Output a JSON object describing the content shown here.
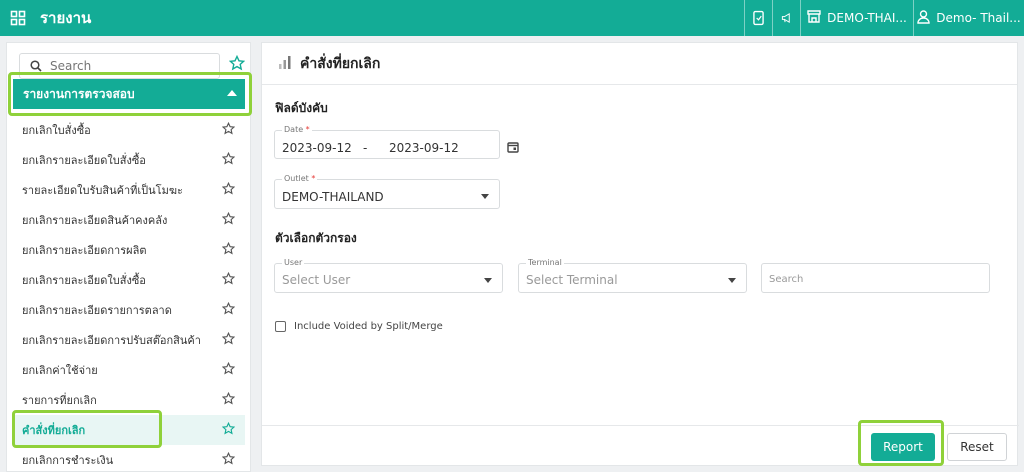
{
  "topbar": {
    "title": "รายงาน",
    "outlet": "DEMO-THAI...",
    "user": "Demo- Thail...",
    "icons": [
      "grid-icon",
      "device-icon",
      "megaphone-icon",
      "store-icon",
      "user-icon"
    ],
    "bg_color": "#13ac96"
  },
  "sidebar": {
    "search_placeholder": "Search",
    "group_label": "รายงานการตรวจสอบ",
    "items": [
      {
        "label": "ยกเลิกใบสั่งซื้อ"
      },
      {
        "label": "ยกเลิกรายละเอียดใบสั่งซื้อ"
      },
      {
        "label": "รายละเอียดใบรับสินค้าที่เป็นโมฆะ"
      },
      {
        "label": "ยกเลิกรายละเอียดสินค้าคงคลัง"
      },
      {
        "label": "ยกเลิกรายละเอียดการผลิต"
      },
      {
        "label": "ยกเลิกรายละเอียดใบสั่งซื้อ"
      },
      {
        "label": "ยกเลิกรายละเอียดรายการตลาด"
      },
      {
        "label": "ยกเลิกรายละเอียดการปรับสต๊อกสินค้า"
      },
      {
        "label": "ยกเลิกค่าใช้จ่าย"
      },
      {
        "label": "รายการที่ยกเลิก"
      },
      {
        "label": "คำสั่งที่ยกเลิก",
        "active": true
      },
      {
        "label": "ยกเลิกการชำระเงิน"
      }
    ]
  },
  "main": {
    "title": "คำสั่งที่ยกเลิก",
    "required_section": "ฟิลด์บังคับ",
    "date": {
      "label": "Date",
      "required": "*",
      "from": "2023-09-12",
      "separator": "-",
      "to": "2023-09-12"
    },
    "outlet": {
      "label": "Outlet",
      "required": "*",
      "value": "DEMO-THAILAND"
    },
    "filter_section": "ตัวเลือกตัวกรอง",
    "user": {
      "label": "User",
      "placeholder": "Select User"
    },
    "terminal": {
      "label": "Terminal",
      "placeholder": "Select Terminal"
    },
    "search_placeholder": "Search",
    "checkbox_label": "Include Voided by Split/Merge",
    "report_button": "Report",
    "reset_button": "Reset"
  },
  "colors": {
    "accent": "#13ac96",
    "highlight": "#8fd13a"
  }
}
